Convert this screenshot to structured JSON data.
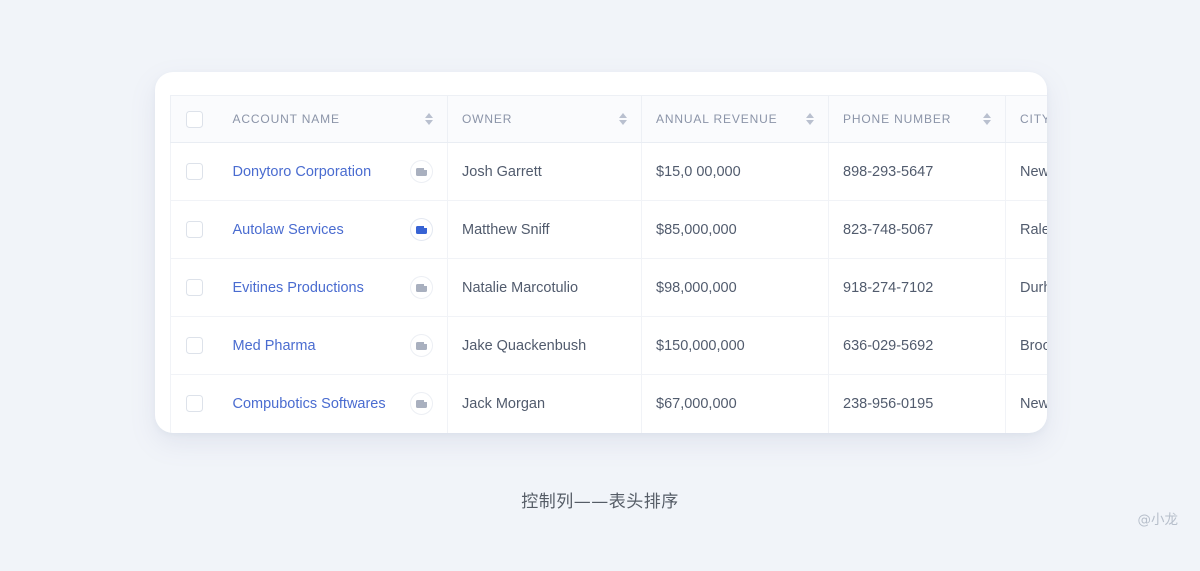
{
  "page": {
    "background_color": "#f1f4f9",
    "caption": "控制列——表头排序",
    "watermark": "@小龙"
  },
  "table": {
    "columns": [
      {
        "key": "check",
        "label": "",
        "sortable": false
      },
      {
        "key": "account_name",
        "label": "ACCOUNT NAME",
        "sortable": true
      },
      {
        "key": "owner",
        "label": "OWNER",
        "sortable": true
      },
      {
        "key": "annual_revenue",
        "label": "ANNUAL REVENUE",
        "sortable": true
      },
      {
        "key": "phone_number",
        "label": "PHONE NUMBER",
        "sortable": true
      },
      {
        "key": "city",
        "label": "CITY",
        "sortable": false
      }
    ],
    "header_select_all_checked": false,
    "rows": [
      {
        "checked": false,
        "account_name": "Donytoro Corporation",
        "badge_icon": "file-card-icon",
        "badge_active": false,
        "owner": "Josh Garrett",
        "annual_revenue": "$15,0 00,000",
        "phone_number": "898-293-5647",
        "city": "New York"
      },
      {
        "checked": false,
        "account_name": "Autolaw Services",
        "badge_icon": "file-card-icon",
        "badge_active": true,
        "owner": "Matthew Sniff",
        "annual_revenue": "$85,000,000",
        "phone_number": "823-748-5067",
        "city": "Raleigh"
      },
      {
        "checked": false,
        "account_name": "Evitines Productions",
        "badge_icon": "file-card-icon",
        "badge_active": false,
        "owner": "Natalie Marcotulio",
        "annual_revenue": "$98,000,000",
        "phone_number": "918-274-7102",
        "city": "Durham"
      },
      {
        "checked": false,
        "account_name": "Med Pharma",
        "badge_icon": "file-card-icon",
        "badge_active": false,
        "owner": "Jake Quackenbush",
        "annual_revenue": "$150,000,000",
        "phone_number": "636-029-5692",
        "city": "Brooklyn"
      },
      {
        "checked": false,
        "account_name": "Compubotics Softwares",
        "badge_icon": "file-card-icon",
        "badge_active": false,
        "owner": "Jack Morgan",
        "annual_revenue": "$67,000,000",
        "phone_number": "238-956-0195",
        "city": "New York"
      }
    ]
  },
  "colors": {
    "link": "#4a6cd0",
    "badge_active": "#3763d4",
    "header_text": "#8b94a8",
    "body_text": "#515b6d",
    "sort_arrow": "#b9c0cf",
    "card": "#ffffff"
  },
  "icons": {
    "sort": "sort-updown-icon",
    "checkbox": "checkbox-icon",
    "badge": "file-card-icon"
  }
}
